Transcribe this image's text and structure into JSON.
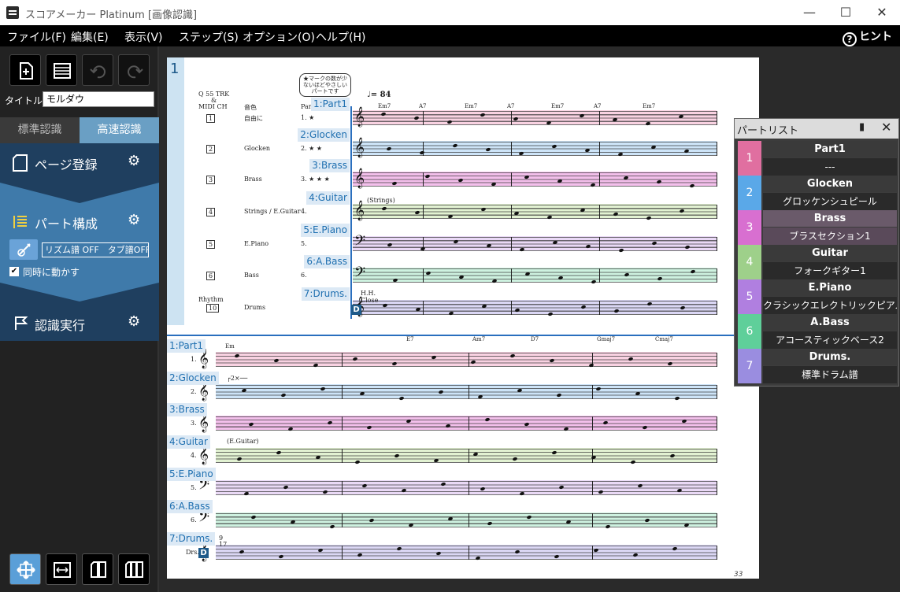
{
  "window": {
    "title": "スコアメーカー Platinum [画像認識]",
    "min_glyph": "—",
    "max_glyph": "☐",
    "close_glyph": "✕"
  },
  "menu": {
    "items": [
      "ファイル(F)",
      "編集(E)",
      "表示(V)",
      "ステップ(S)",
      "オプション(O)",
      "ヘルプ(H)"
    ],
    "hint_label": "ヒント",
    "hint_glyph": "?"
  },
  "sidebar": {
    "title_label": "タイトル",
    "title_value": "モルダウ",
    "tab_standard": "標準認識",
    "tab_fast": "高速認識",
    "step_page": "ページ登録",
    "step_part": "パート構成",
    "step_run": "認識実行",
    "gear_glyph": "⚙",
    "rhythm_field": "リズム譜 OFF　タブ譜OFF",
    "sync_label": "同時に動かす",
    "sync_checked_glyph": "✔"
  },
  "score": {
    "page_number": "1",
    "header_q": "Q 55 TRK",
    "header_and": "&",
    "header_midi": "MIDI CH",
    "header_tone": "音色",
    "header_par": "Part",
    "header_note": "★マークの数が少ないほどやさしいパートです",
    "tempo": "♩= 84",
    "rows_top": [
      {
        "tag": "1:Part1",
        "ch": "1",
        "inst": "自由に",
        "stars": "1.  ★"
      },
      {
        "tag": "2:Glocken",
        "ch": "2",
        "inst": "Glocken",
        "stars": "2.  ★ ★"
      },
      {
        "tag": "3:Brass",
        "ch": "3",
        "inst": "Brass",
        "stars": "3.  ★ ★ ★"
      },
      {
        "tag": "4:Guitar",
        "ch": "4",
        "inst": "Strings / E.Guitar",
        "stars": "4."
      },
      {
        "tag": "5:E.Piano",
        "ch": "5",
        "inst": "E.Piano",
        "stars": "5."
      },
      {
        "tag": "6:A.Bass",
        "ch": "6",
        "inst": "Bass",
        "stars": "6."
      },
      {
        "tag": "7:Drums.",
        "ch": "10",
        "inst": "Drums",
        "stars": ""
      }
    ],
    "rhythm_label": "Rhythm",
    "strings_label": "(Strings)",
    "hh_label": "H.H.",
    "close_label": "Close",
    "chords_top": [
      "Em7",
      "A7",
      "Em7",
      "A7",
      "Em7",
      "A7",
      "Em7"
    ],
    "chords_bottom": [
      "Em",
      "E7",
      "Am7",
      "D7",
      "Gmaj7",
      "Cmaj7"
    ],
    "repeat_label": "┌2×──",
    "eguitar_label": "(E.Guitar)",
    "bottom_tags": [
      "1:Part1",
      "2:Glocken",
      "3:Brass",
      "4:Guitar",
      "5:E.Piano",
      "6:A.Bass",
      "7:Drums."
    ],
    "bottom_nums": [
      "1.",
      "2.",
      "3.",
      "4.",
      "5.",
      "6.",
      "Drs."
    ],
    "measure_9": "9",
    "measure_17": "17",
    "drums_badge": "D",
    "page_corner": "33"
  },
  "partlist": {
    "title": "パートリスト",
    "pin_glyph": "▮",
    "close_glyph": "✕",
    "parts": [
      {
        "num": "1",
        "name": "Part1",
        "inst": "---",
        "color": "#e06fa0"
      },
      {
        "num": "2",
        "name": "Glocken",
        "inst": "グロッケンシュピール",
        "color": "#5aa8e8"
      },
      {
        "num": "3",
        "name": "Brass",
        "inst": "ブラスセクション1",
        "color": "#d86fd0"
      },
      {
        "num": "4",
        "name": "Guitar",
        "inst": "フォークギター1",
        "color": "#9ed08a"
      },
      {
        "num": "5",
        "name": "E.Piano",
        "inst": "クラシックエレクトリックピアノ1",
        "color": "#b07fe0"
      },
      {
        "num": "6",
        "name": "A.Bass",
        "inst": "アコースティックベース2",
        "color": "#5fcf9a"
      },
      {
        "num": "7",
        "name": "Drums.",
        "inst": "標準ドラム譜",
        "color": "#9a8de0"
      }
    ],
    "selected_index": 2
  },
  "colors": {
    "part1": "#f4a6c6",
    "glocken": "#9ccaf2",
    "brass": "#e87fd8",
    "guitar": "#c6e6a6",
    "epiano": "#d6b4ee",
    "abass": "#9ee6c2",
    "drums": "#b8b0ec"
  }
}
